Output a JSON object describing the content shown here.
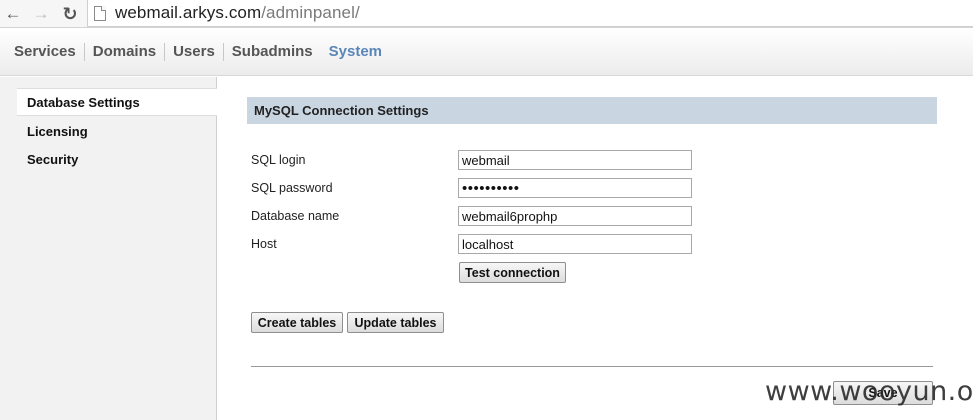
{
  "browser": {
    "url_host": "webmail.arkys.com",
    "url_path": "/adminpanel/"
  },
  "topmenu": {
    "items": [
      {
        "label": "Services"
      },
      {
        "label": "Domains"
      },
      {
        "label": "Users"
      },
      {
        "label": "Subadmins"
      },
      {
        "label": "System"
      }
    ],
    "active": "System",
    "active_color": "#5a86b8"
  },
  "sidebar": {
    "items": [
      {
        "label": "Database Settings"
      },
      {
        "label": "Licensing"
      },
      {
        "label": "Security"
      }
    ],
    "selected": "Database Settings"
  },
  "panel": {
    "title": "MySQL Connection Settings",
    "header_color": "#c9d5e1",
    "fields": {
      "sql_login": {
        "label": "SQL login",
        "value": "webmail"
      },
      "sql_password": {
        "label": "SQL password",
        "value": "••••••••••"
      },
      "database_name": {
        "label": "Database name",
        "value": "webmail6prophp"
      },
      "host": {
        "label": "Host",
        "value": "localhost"
      }
    },
    "test_connection_label": "Test connection",
    "create_tables_label": "Create tables",
    "update_tables_label": "Update tables",
    "save_label": "Save"
  },
  "watermark": "www.wooyun.org"
}
